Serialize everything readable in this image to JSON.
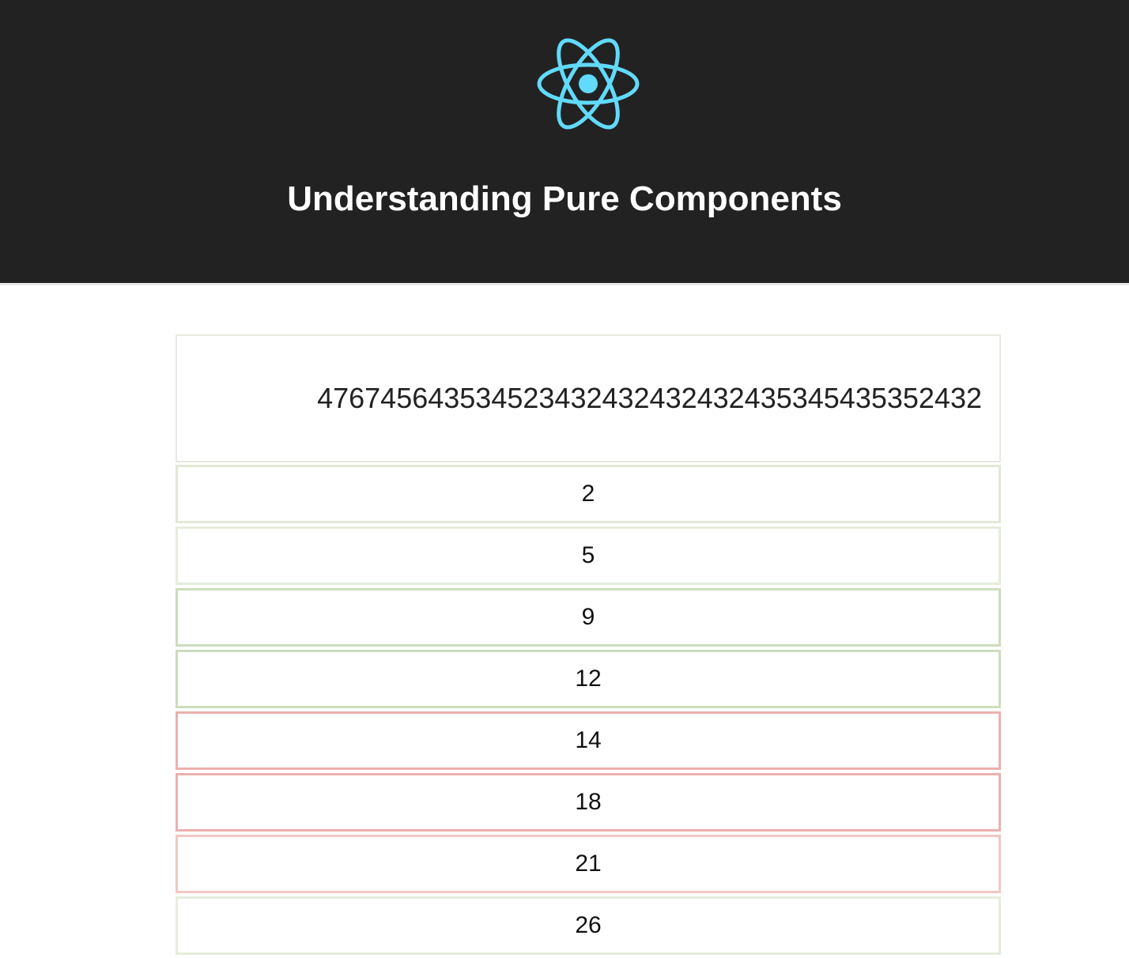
{
  "header": {
    "logo_icon": "react-atom-icon",
    "logo_color": "#61dafb",
    "background": "#222222",
    "title": "Understanding Pure Components"
  },
  "input": {
    "value": "476745643534523432432432432435345435352432"
  },
  "list": {
    "items": [
      {
        "label": "2",
        "status": "unchanged"
      },
      {
        "label": "5",
        "status": "unchanged"
      },
      {
        "label": "9",
        "status": "rendered"
      },
      {
        "label": "12",
        "status": "rendered"
      },
      {
        "label": "14",
        "status": "re-rendered"
      },
      {
        "label": "18",
        "status": "re-rendered"
      },
      {
        "label": "21",
        "status": "re-rendered"
      },
      {
        "label": "26",
        "status": "unchanged"
      }
    ],
    "status_colors": {
      "unchanged": "#e1e9d6",
      "rendered": "#cddcbd",
      "re-rendered": "#ecb0ad"
    }
  }
}
